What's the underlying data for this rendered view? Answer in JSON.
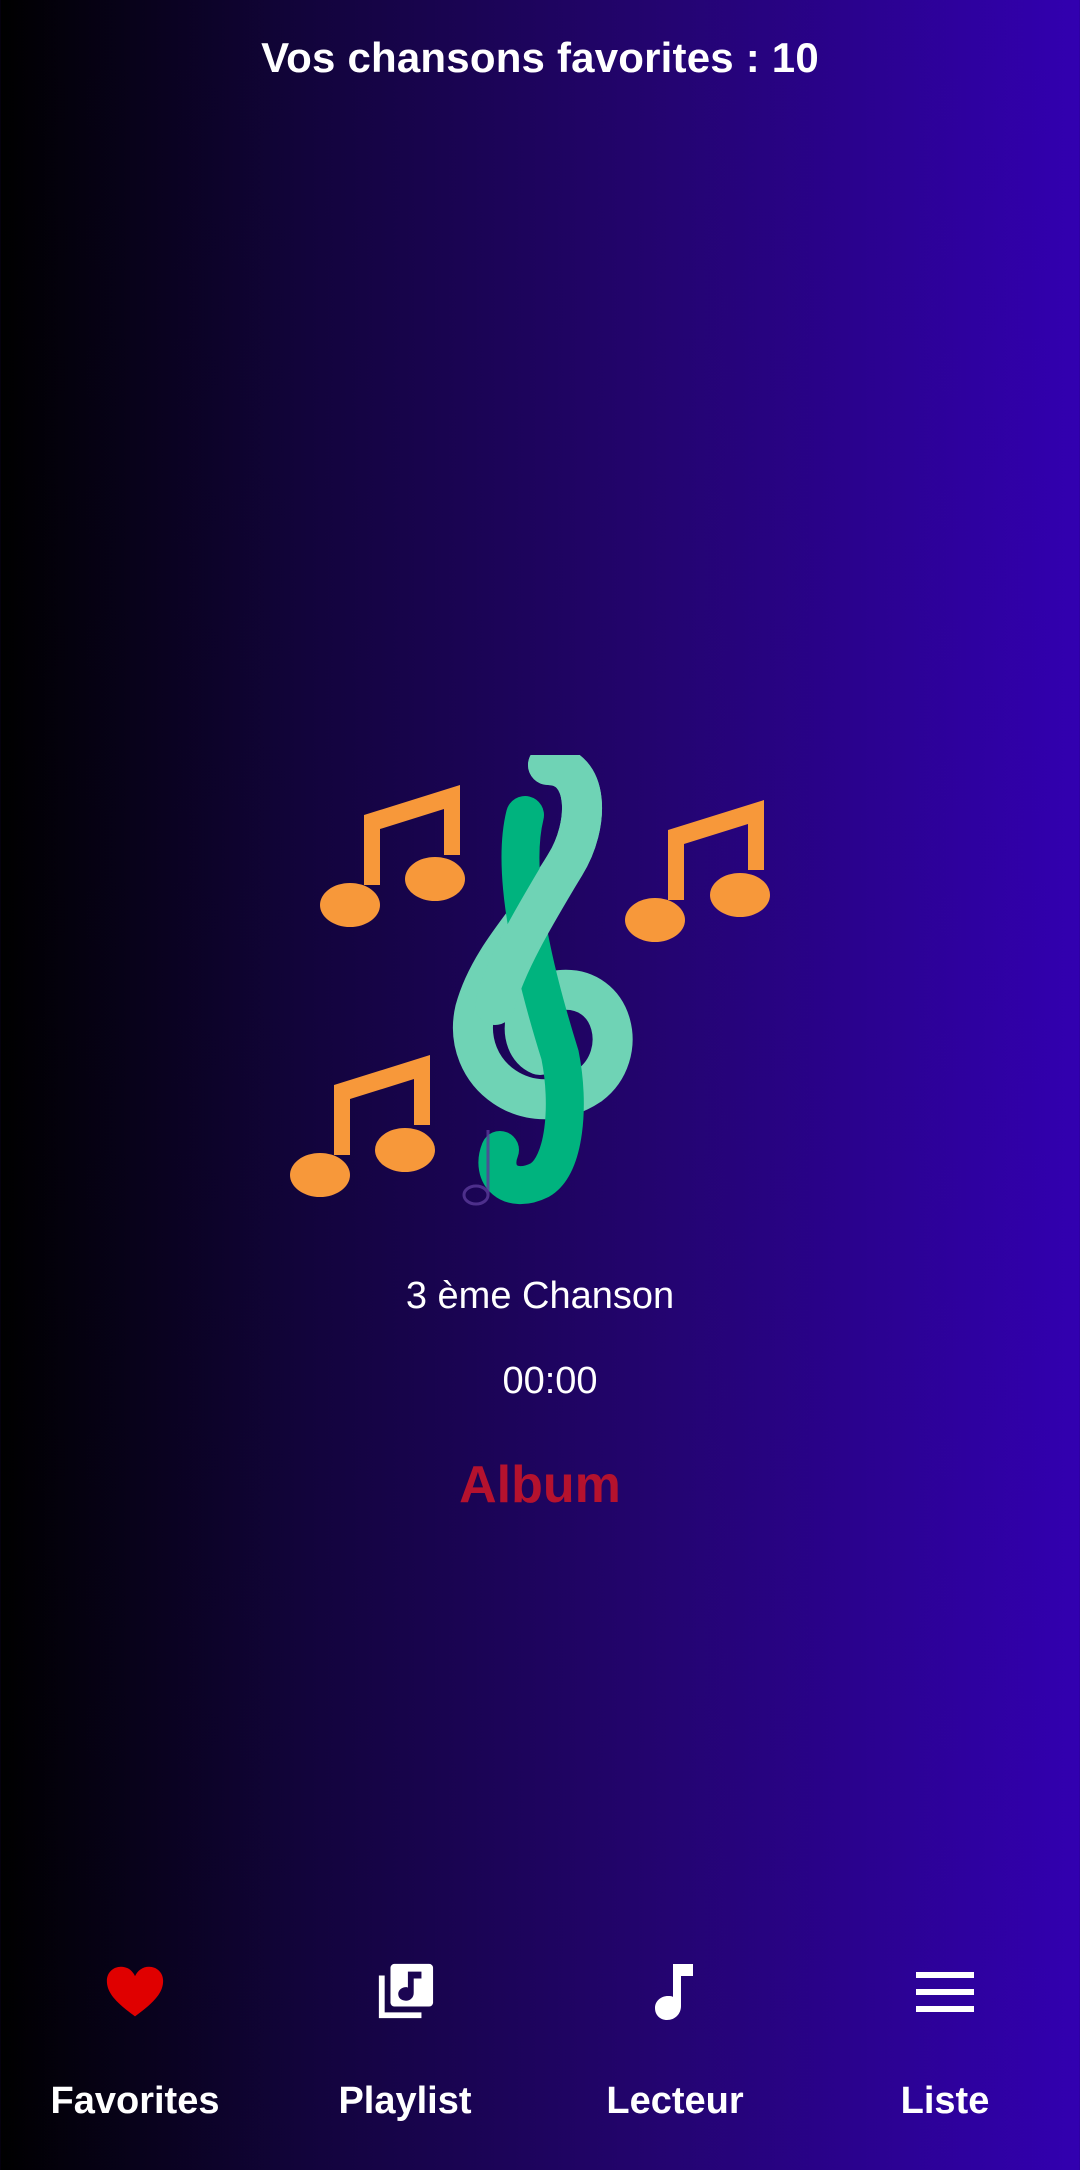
{
  "header": {
    "title": "Vos chansons favorites : 10"
  },
  "player": {
    "song_title": "3 ème Chanson",
    "time": "00:00",
    "album_label": "Album"
  },
  "colors": {
    "accent_red": "#b5122e",
    "heart_red": "#e00000",
    "note_orange": "#f7983a",
    "clef_green_light": "#6fd3b5",
    "clef_green_dark": "#00b37e"
  },
  "nav": {
    "items": [
      {
        "label": "Favorites",
        "icon": "heart-icon"
      },
      {
        "label": "Playlist",
        "icon": "playlist-icon"
      },
      {
        "label": "Lecteur",
        "icon": "music-note-icon"
      },
      {
        "label": "Liste",
        "icon": "menu-icon"
      }
    ]
  }
}
